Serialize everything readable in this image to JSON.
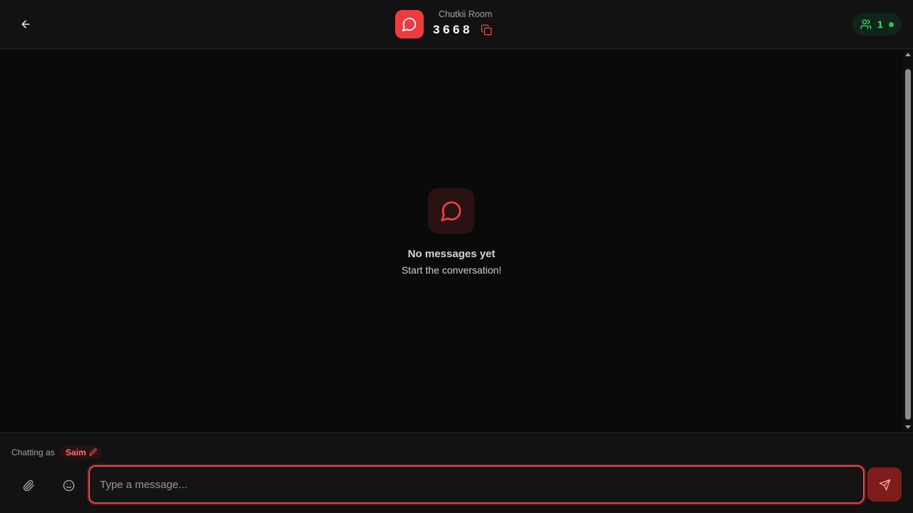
{
  "header": {
    "room_title": "Chutkii Room",
    "room_code": "3668",
    "members_count": "1",
    "icons": {
      "back": "arrow-left-icon",
      "logo": "message-circle-icon",
      "copy": "copy-icon",
      "members": "users-icon"
    }
  },
  "empty_state": {
    "title": "No messages yet",
    "subtitle": "Start the conversation!"
  },
  "composer": {
    "chatting_as_label": "Chatting as",
    "username": "Saim",
    "input_value": "",
    "placeholder": "Type a message..."
  },
  "colors": {
    "accent": "#ef4444",
    "accent_dark": "#7f1d1d",
    "online": "#22c55e",
    "background": "#0a0a0a",
    "panel": "#121212"
  }
}
